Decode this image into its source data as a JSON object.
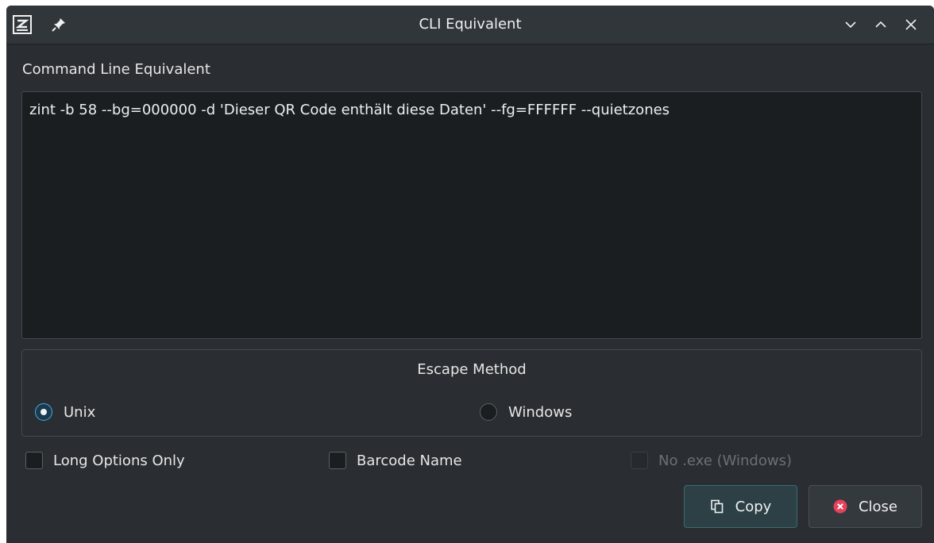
{
  "window": {
    "title": "CLI Equivalent"
  },
  "titlebar": {
    "app_icon": "zint-logo-icon",
    "pin_icon": "pin-icon",
    "buttons": [
      "minimize-icon",
      "maximize-icon",
      "close-icon"
    ]
  },
  "command": {
    "label": "Command Line Equivalent",
    "text": "zint -b 58 --bg=000000 -d 'Dieser QR Code enthält diese Daten' --fg=FFFFFF --quietzones"
  },
  "escape_method": {
    "title": "Escape Method",
    "options": [
      {
        "label": "Unix",
        "checked": true
      },
      {
        "label": "Windows",
        "checked": false
      }
    ]
  },
  "options": [
    {
      "label": "Long Options Only",
      "checked": false,
      "enabled": true
    },
    {
      "label": "Barcode Name",
      "checked": false,
      "enabled": true
    },
    {
      "label": "No .exe (Windows)",
      "checked": false,
      "enabled": false
    }
  ],
  "buttons": {
    "copy_label": "Copy",
    "close_label": "Close"
  },
  "colors": {
    "accent": "#3daee9",
    "close_icon_red": "#e8415c",
    "background": "#2a2e32"
  }
}
